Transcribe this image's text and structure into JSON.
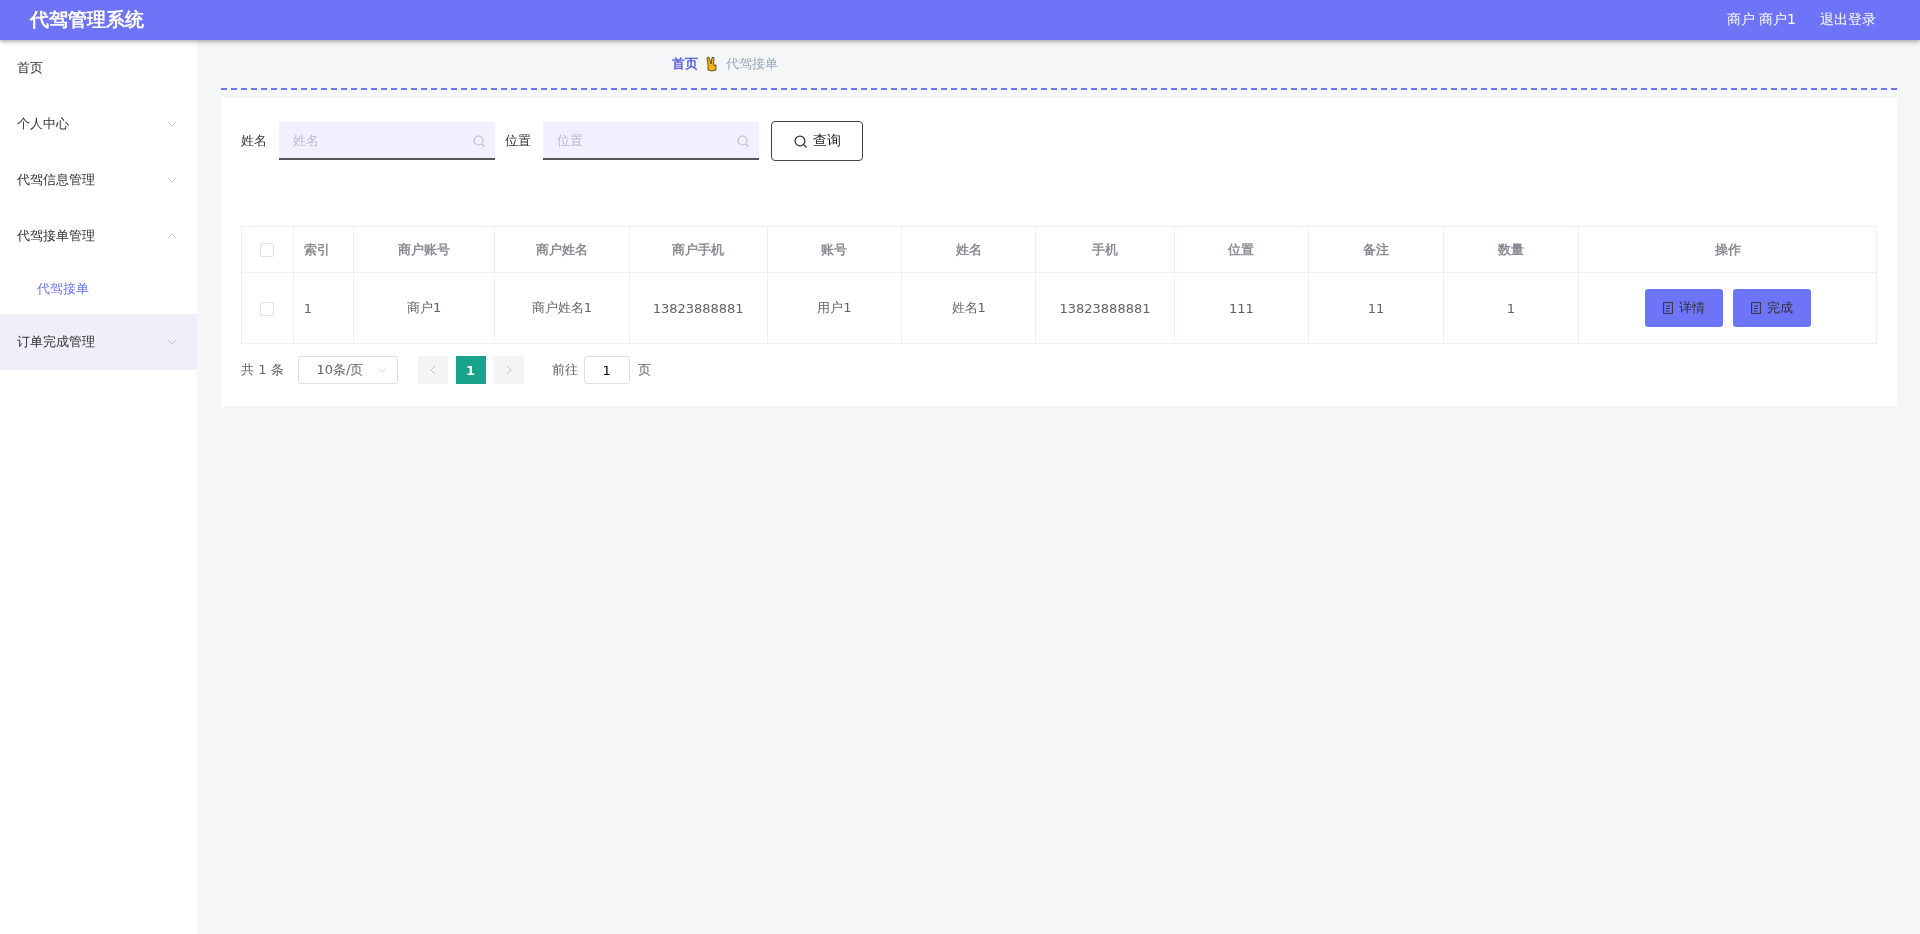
{
  "header": {
    "title": "代驾管理系统",
    "user": "商户 商户1",
    "logout": "退出登录"
  },
  "sidebar": {
    "items": [
      {
        "label": "首页",
        "kind": "link",
        "hovered": false
      },
      {
        "label": "个人中心",
        "kind": "submenu",
        "expanded": false,
        "hovered": false
      },
      {
        "label": "代驾信息管理",
        "kind": "submenu",
        "expanded": false,
        "hovered": false
      },
      {
        "label": "代驾接单管理",
        "kind": "submenu",
        "expanded": true,
        "hovered": false,
        "children": [
          {
            "label": "代驾接单",
            "selected": true
          }
        ]
      },
      {
        "label": "订单完成管理",
        "kind": "submenu",
        "expanded": false,
        "hovered": true
      }
    ]
  },
  "breadcrumb": [
    "首页",
    "代驾接单"
  ],
  "search": {
    "fields": [
      {
        "label": "姓名",
        "placeholder": "姓名"
      },
      {
        "label": "位置",
        "placeholder": "位置"
      }
    ],
    "button": "查询"
  },
  "table": {
    "all_checked": false,
    "columns": [
      "索引",
      "商户账号",
      "商户姓名",
      "商户手机",
      "账号",
      "姓名",
      "手机",
      "位置",
      "备注",
      "数量",
      "操作"
    ],
    "rows": [
      {
        "checked": false,
        "cells": [
          "1",
          "商户1",
          "商户姓名1",
          "13823888881",
          "用户1",
          "姓名1",
          "13823888881",
          "111",
          "11",
          "1"
        ],
        "actions": [
          "详情",
          "完成"
        ]
      }
    ]
  },
  "pagination": {
    "total": "共 1 条",
    "page_size": "10条/页",
    "pages": [
      {
        "label": "1",
        "selected": true
      }
    ],
    "goto_label": "前往",
    "goto_value": "1",
    "page_suffix": "页"
  }
}
